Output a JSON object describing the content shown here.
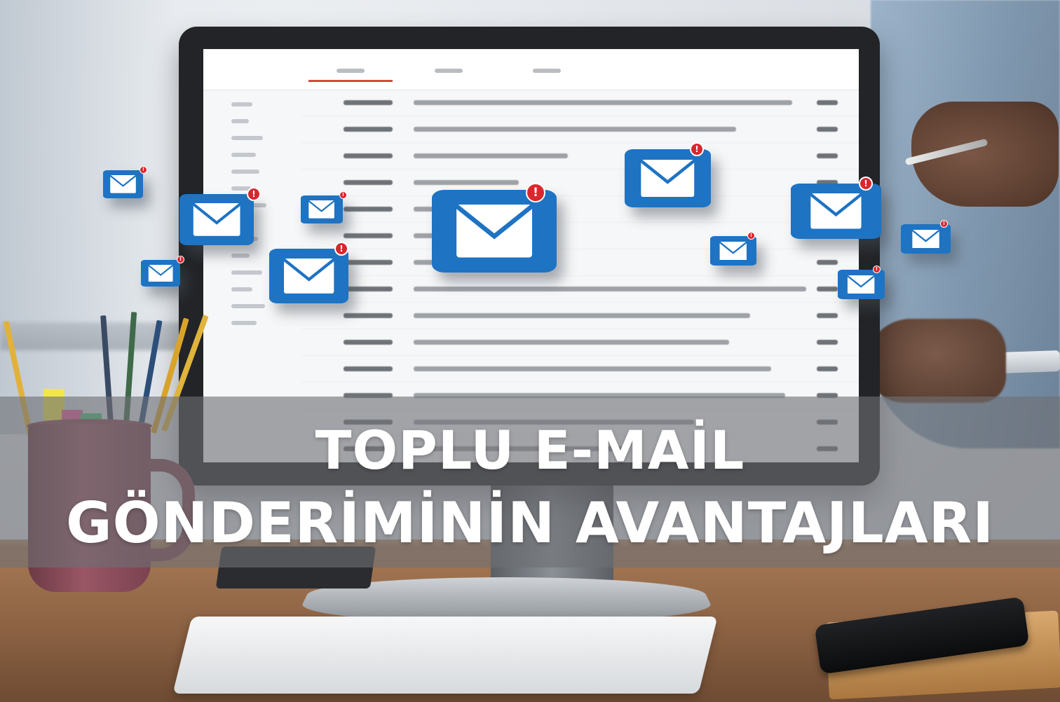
{
  "title": {
    "line1": "TOPLU E-MAİL",
    "line2": "GÖNDERİMİNİN AVANTAJLARI"
  },
  "icons": {
    "envelope": "email-envelope-icon",
    "badge_symbol": "!"
  },
  "colors": {
    "envelope_blue": "#1e73c3",
    "badge_red": "#d9272e",
    "title_text": "#ffffff",
    "band_overlay": "#6e7074"
  }
}
